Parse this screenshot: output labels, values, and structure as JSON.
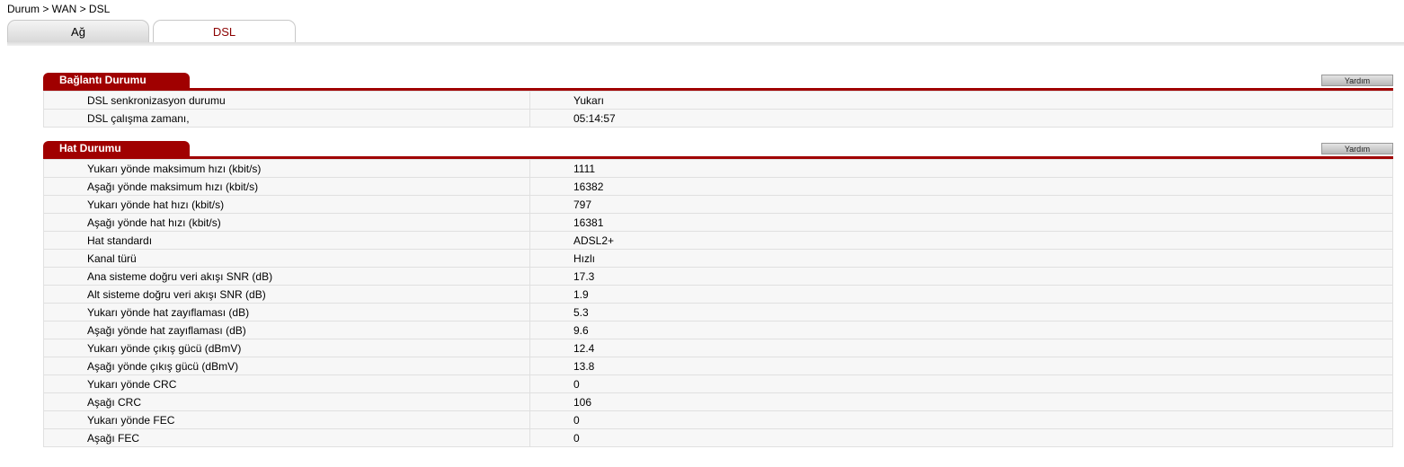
{
  "breadcrumb": "Durum > WAN > DSL",
  "tabs": [
    {
      "label": "Ağ"
    },
    {
      "label": "DSL"
    }
  ],
  "connection_status": {
    "title": "Bağlantı Durumu",
    "help_label": "Yardım",
    "rows": [
      {
        "label": "DSL senkronizasyon durumu",
        "value": "Yukarı"
      },
      {
        "label": "DSL çalışma zamanı,",
        "value": "05:14:57"
      }
    ]
  },
  "line_status": {
    "title": "Hat Durumu",
    "help_label": "Yardım",
    "rows": [
      {
        "label": "Yukarı yönde maksimum hızı (kbit/s)",
        "value": "1111"
      },
      {
        "label": "Aşağı yönde maksimum hızı (kbit/s)",
        "value": "16382"
      },
      {
        "label": "Yukarı yönde hat hızı (kbit/s)",
        "value": "797"
      },
      {
        "label": "Aşağı yönde hat hızı (kbit/s)",
        "value": "16381"
      },
      {
        "label": "Hat standardı",
        "value": "ADSL2+"
      },
      {
        "label": "Kanal türü",
        "value": "Hızlı"
      },
      {
        "label": "Ana sisteme doğru veri akışı SNR (dB)",
        "value": "17.3"
      },
      {
        "label": "Alt sisteme doğru veri akışı SNR (dB)",
        "value": "1.9"
      },
      {
        "label": "Yukarı yönde hat zayıflaması (dB)",
        "value": "5.3"
      },
      {
        "label": "Aşağı yönde hat zayıflaması (dB)",
        "value": "9.6"
      },
      {
        "label": "Yukarı yönde çıkış gücü (dBmV)",
        "value": "12.4"
      },
      {
        "label": "Aşağı yönde çıkış gücü (dBmV)",
        "value": "13.8"
      },
      {
        "label": "Yukarı yönde CRC",
        "value": "0"
      },
      {
        "label": "Aşağı CRC",
        "value": "106"
      },
      {
        "label": "Yukarı yönde FEC",
        "value": "0"
      },
      {
        "label": "Aşağı FEC",
        "value": "0"
      }
    ]
  }
}
